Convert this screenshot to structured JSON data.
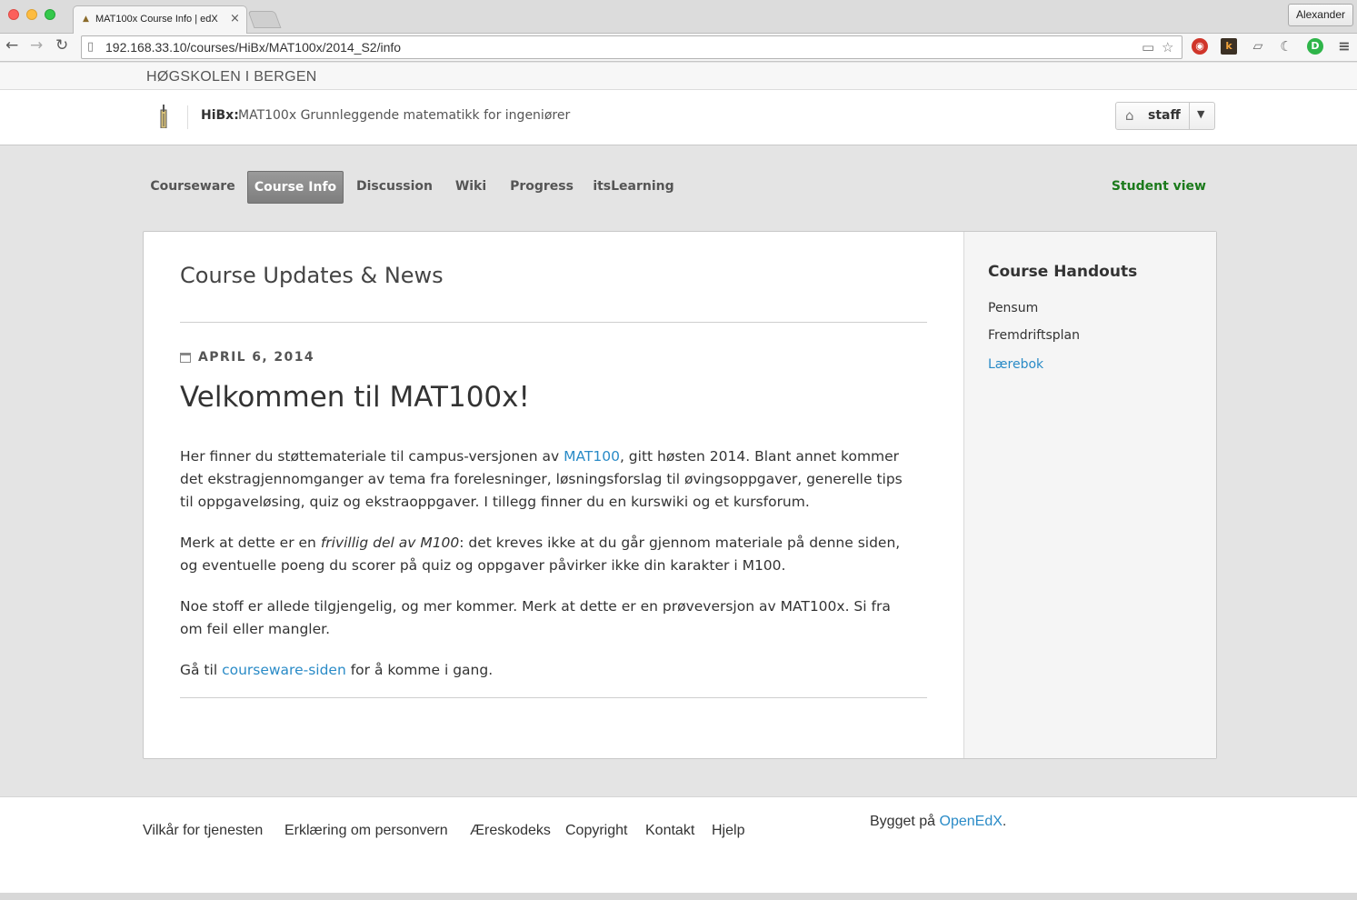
{
  "browser": {
    "tab_title": "MAT100x Course Info | edX",
    "tab_close": "×",
    "profile": "Alexander",
    "url": "192.168.33.10/courses/HiBx/MAT100x/2014_S2/info"
  },
  "institution": "HØGSKOLEN I BERGEN",
  "header": {
    "org": "HiBx:",
    "course_title": "MAT100x Grunnleggende matematikk for ingeniører",
    "user": "staff"
  },
  "nav": {
    "tabs": [
      {
        "label": "Courseware"
      },
      {
        "label": "Course Info"
      },
      {
        "label": "Discussion"
      },
      {
        "label": "Wiki"
      },
      {
        "label": "Progress"
      },
      {
        "label": "itsLearning"
      }
    ],
    "active": "Course Info",
    "student_view": "Student view"
  },
  "updates": {
    "heading": "Course Updates & News",
    "date": "APRIL 6, 2014",
    "title": "Velkommen til MAT100x!",
    "p1_a": "Her finner du støttemateriale til campus-versjonen av ",
    "p1_link": "MAT100",
    "p1_b": ", gitt høsten 2014. Blant annet kommer det ekstragjennomganger av tema fra forelesninger, løsningsforslag til øvingsoppgaver, generelle tips til oppgaveløsing, quiz og ekstraoppgaver. I tillegg finner du en kurswiki og et kursforum.",
    "p2_a": "Merk at dette er en ",
    "p2_em": "frivillig del av M100",
    "p2_b": ": det kreves ikke at du går gjennom materiale på denne siden, og eventuelle poeng du scorer på quiz og oppgaver påvirker ikke din karakter i M100.",
    "p3": "Noe stoff er allede tilgjengelig, og mer kommer. Merk at dette er en prøveversjon av MAT100x. Si fra om feil eller mangler.",
    "p4_a": "Gå til ",
    "p4_link": "courseware-siden",
    "p4_b": " for å komme i gang."
  },
  "handouts": {
    "title": "Course Handouts",
    "items": [
      {
        "label": "Pensum"
      },
      {
        "label": "Fremdriftsplan"
      },
      {
        "label": "Lærebok"
      }
    ]
  },
  "footer": {
    "links": [
      {
        "label": "Vilkår for tjenesten"
      },
      {
        "label": "Erklæring om personvern"
      },
      {
        "label": "Æreskodeks"
      },
      {
        "label": "Copyright"
      },
      {
        "label": "Kontakt"
      },
      {
        "label": "Hjelp"
      }
    ],
    "built_prefix": "Bygget på ",
    "built_link": "OpenEdX",
    "built_suffix": "."
  },
  "colors": {
    "link": "#2a8bc7",
    "student_view": "#1b7a1b",
    "active_tab": "#8a8a8a"
  }
}
